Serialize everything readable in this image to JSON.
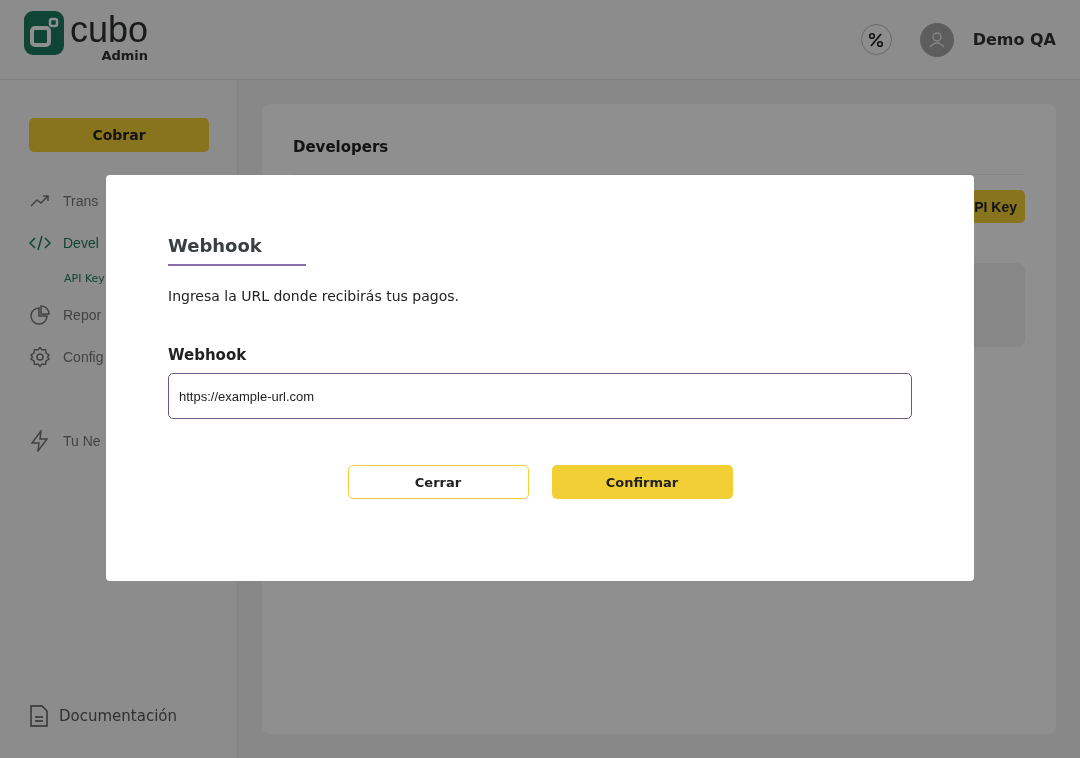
{
  "header": {
    "brand": "cubo",
    "brand_sub": "Admin",
    "user_name": "Demo QA"
  },
  "sidebar": {
    "primary_button": "Cobrar",
    "items": [
      {
        "label": "Trans",
        "selected": false
      },
      {
        "label": "Devel",
        "selected": true,
        "children": [
          {
            "label": "API Key",
            "selected": true
          }
        ]
      },
      {
        "label": "Repor",
        "selected": false
      },
      {
        "label": "Config",
        "selected": false
      },
      {
        "label": "Tu Ne",
        "selected": false
      }
    ],
    "footer_link": "Documentación"
  },
  "page": {
    "title": "Developers",
    "button": "PI Key"
  },
  "modal": {
    "title": "Webhook",
    "description": "Ingresa la URL donde recibirás tus pagos.",
    "field_label": "Webhook",
    "field_value": "https://example-url.com",
    "buttons": [
      {
        "label": "Cerrar",
        "kind": "secondary"
      },
      {
        "label": "Confirmar",
        "kind": "primary"
      }
    ]
  }
}
